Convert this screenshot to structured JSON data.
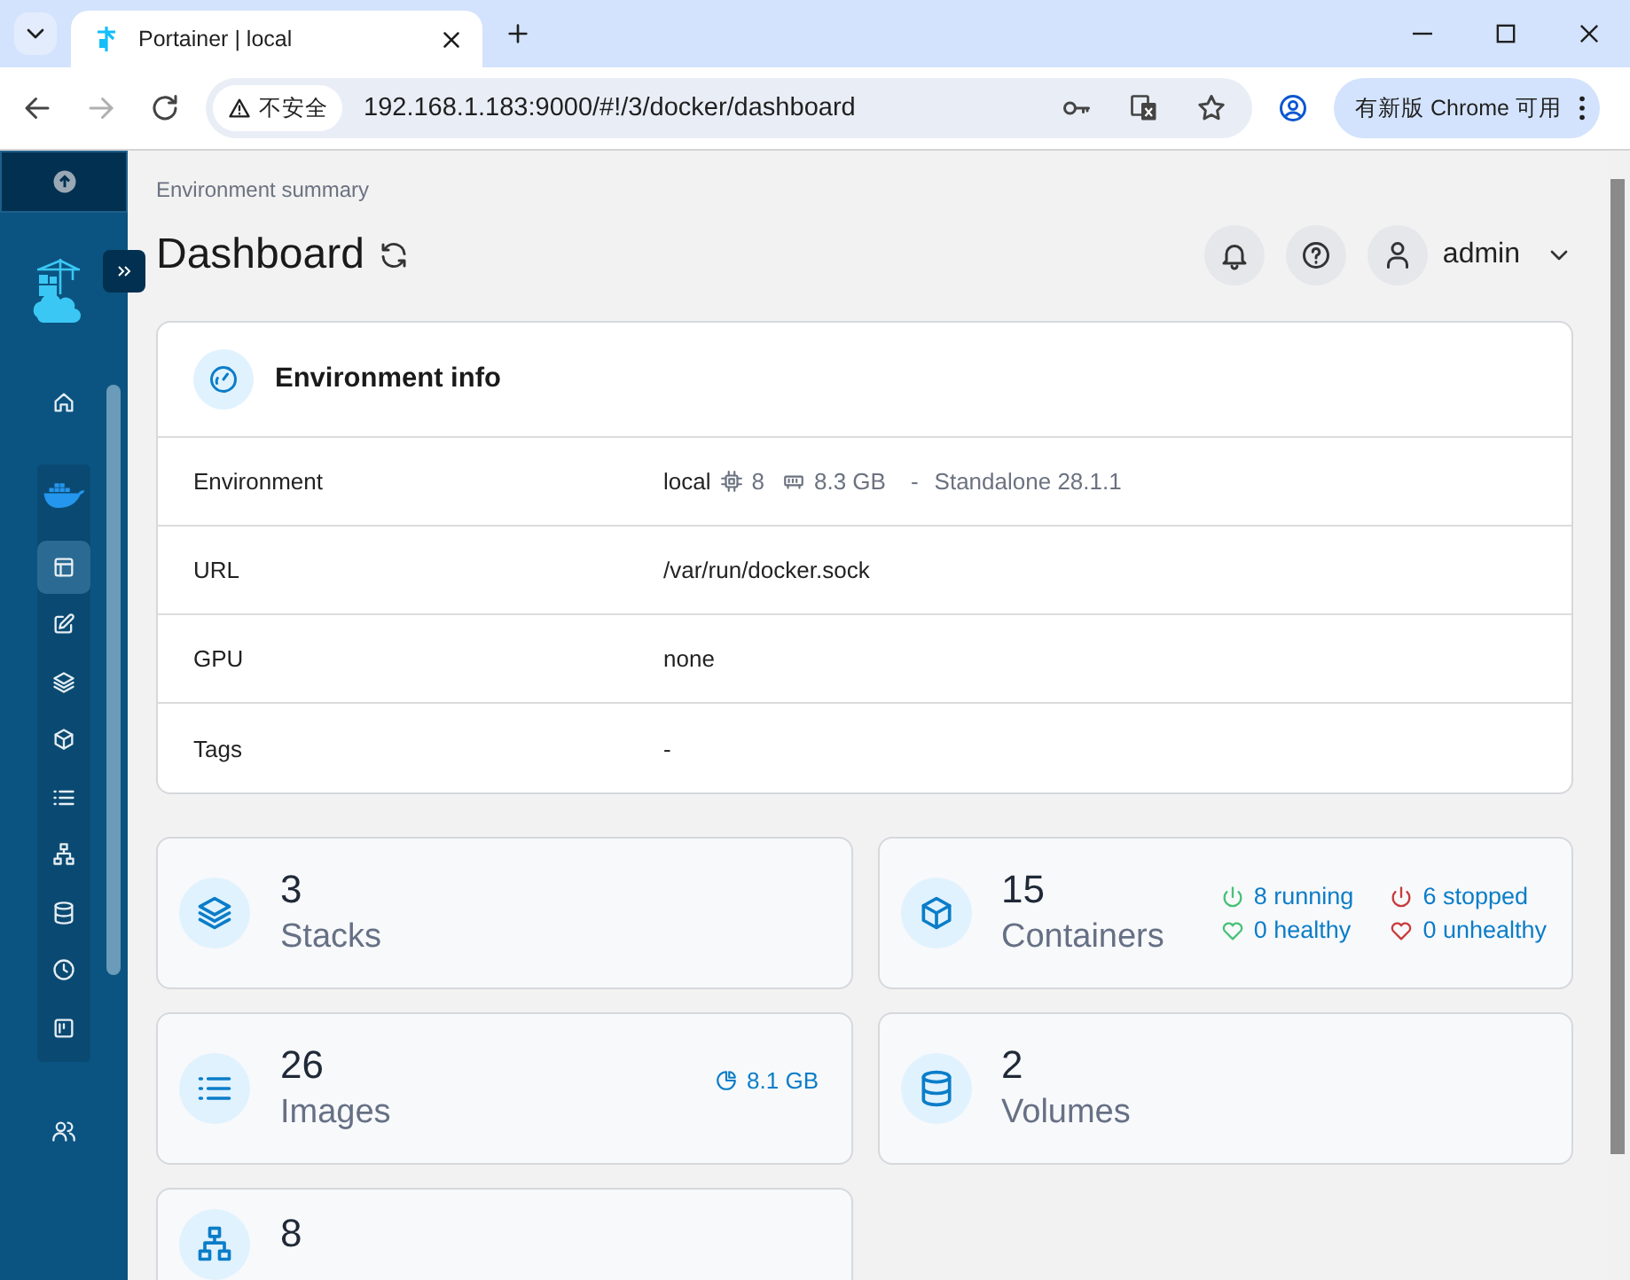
{
  "browser": {
    "tab_title": "Portainer | local",
    "security": "不安全",
    "url": "192.168.1.183:9000/#!/3/docker/dashboard",
    "update_button": "有新版 Chrome 可用"
  },
  "sidebar": {
    "top": [
      {
        "kind": "home",
        "selected": false
      }
    ],
    "docker_items": [
      {
        "kind": "dashboard",
        "selected": true
      },
      {
        "kind": "templates",
        "selected": false
      },
      {
        "kind": "stacks",
        "selected": false
      },
      {
        "kind": "containers",
        "selected": false
      },
      {
        "kind": "images",
        "selected": false
      },
      {
        "kind": "networks",
        "selected": false
      },
      {
        "kind": "volumes",
        "selected": false
      },
      {
        "kind": "events",
        "selected": false
      },
      {
        "kind": "host",
        "selected": false
      }
    ],
    "bottom": [
      {
        "kind": "users",
        "selected": false
      }
    ]
  },
  "header": {
    "breadcrumb": "Environment summary",
    "title": "Dashboard",
    "user": "admin"
  },
  "environment_info": {
    "title": "Environment info",
    "rows": [
      {
        "kind": "environment",
        "label": "Environment",
        "name": "local",
        "cpu": "8",
        "memory": "8.3 GB",
        "separator": "-",
        "engine": "Standalone 28.1.1"
      },
      {
        "kind": "text",
        "label": "URL",
        "value": "/var/run/docker.sock"
      },
      {
        "kind": "text",
        "label": "GPU",
        "value": "none"
      },
      {
        "kind": "text",
        "label": "Tags",
        "value": "-"
      }
    ]
  },
  "stats": [
    {
      "kind": "stacks",
      "count": "3",
      "label": "Stacks"
    },
    {
      "kind": "containers",
      "count": "15",
      "label": "Containers",
      "statuses": [
        {
          "kind": "running",
          "color": "#46c277",
          "text": "8 running"
        },
        {
          "kind": "stopped",
          "color": "#c83b3b",
          "text": "6 stopped"
        },
        {
          "kind": "healthy",
          "color": "#46c277",
          "text": "0 healthy"
        },
        {
          "kind": "unhealthy",
          "color": "#c83b3b",
          "text": "0 unhealthy"
        }
      ]
    },
    {
      "kind": "images",
      "count": "26",
      "label": "Images",
      "size": "8.1 GB"
    },
    {
      "kind": "volumes",
      "count": "2",
      "label": "Volumes"
    },
    {
      "kind": "networks",
      "count": "8"
    }
  ]
}
